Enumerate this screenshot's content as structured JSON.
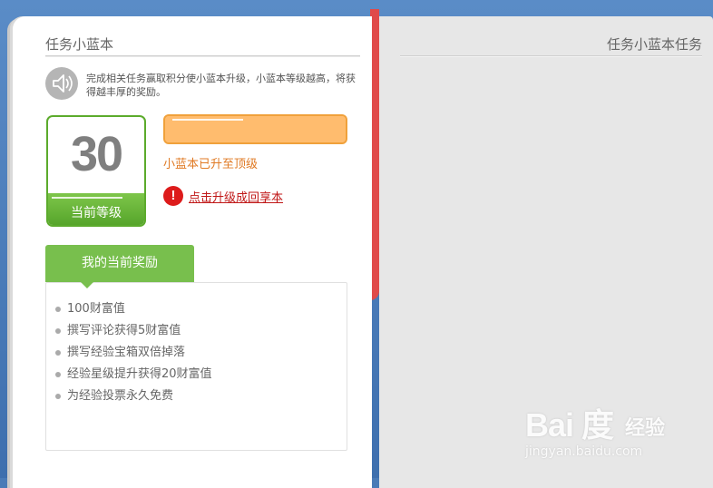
{
  "left_page": {
    "title": "任务小蓝本",
    "intro": "完成相关任务赢取积分使小蓝本升级，小蓝本等级越高，将获得越丰厚的奖励。",
    "level_value": "30",
    "level_label": "当前等级",
    "progress_fraction": 1.0,
    "status_text": "小蓝本已升至顶级",
    "revert_link": "点击升级成回享本",
    "alert_symbol": "!",
    "reward_tab": "我的当前奖励",
    "rewards": [
      "100财富值",
      "撰写评论获得5财富值",
      "撰写经验宝箱双倍掉落",
      "经验星级提升获得20财富值",
      "为经验投票永久免费"
    ]
  },
  "right_page": {
    "title": "任务小蓝本任务"
  },
  "watermark": {
    "logo": "Bai 度",
    "logo_cn": "经验",
    "url": "jingyan.baidu.com"
  },
  "colors": {
    "book_blue": "#4a7bb7",
    "spine_red": "#e04a4a",
    "level_green": "#5cab2c",
    "progress_orange": "#ffbc6e",
    "status_orange": "#e07a24",
    "alert_red": "#dd1b1b"
  },
  "icons": {
    "speaker": "speaker-icon",
    "alert": "alert-icon"
  }
}
